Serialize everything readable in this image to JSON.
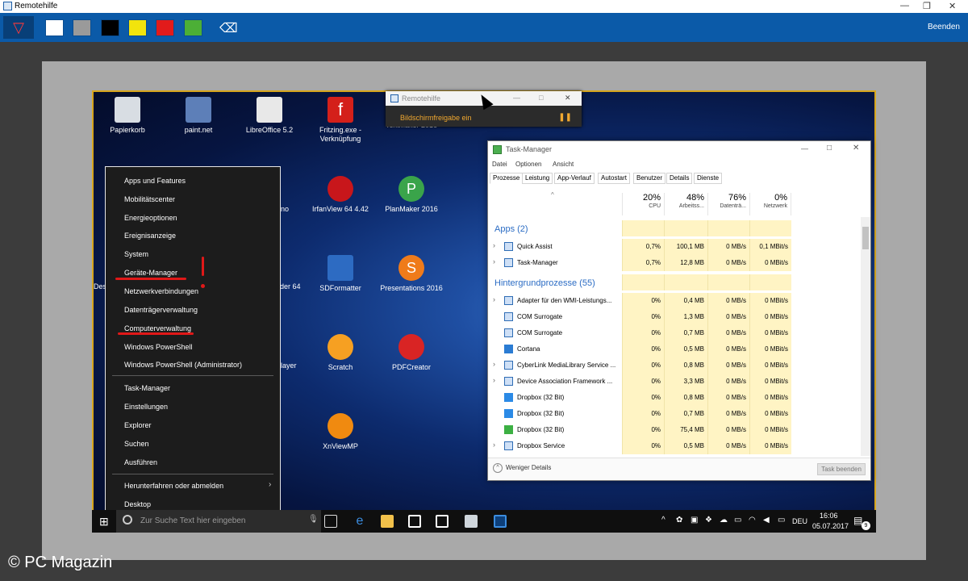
{
  "window": {
    "title": "Remotehilfe"
  },
  "toolbar": {
    "swatches": [
      "#ffffff",
      "#9a9a9a",
      "#000000",
      "#f2e40c",
      "#e21b1b",
      "#4caf36"
    ],
    "finish_label": "Beenden"
  },
  "remote_bar": {
    "title": "Remotehilfe",
    "status": "Bildschirmfreigabe ein"
  },
  "desktop_icons": [
    {
      "label": "Papierkorb"
    },
    {
      "label": "paint.net"
    },
    {
      "label": "LibreOffice 5.2"
    },
    {
      "label": "Fritzing.exe - Verknüpfung"
    },
    {
      "label": "TextMaker 2016"
    },
    {
      "label": "IrfanView 64 4.42"
    },
    {
      "label": "PlanMaker 2016"
    },
    {
      "label": "SDFormatter"
    },
    {
      "label": "Presentations 2016"
    },
    {
      "label": "Scratch"
    },
    {
      "label": "PDFCreator"
    },
    {
      "label": "XnViewMP"
    },
    {
      "label": "Desi"
    },
    {
      "label": "ino"
    },
    {
      "label": "ader 64"
    },
    {
      "label": "layer"
    }
  ],
  "context_menu": {
    "items": [
      "Apps und Features",
      "Mobilitätscenter",
      "Energieoptionen",
      "Ereignisanzeige",
      "System",
      "Geräte-Manager",
      "Netzwerkverbindungen",
      "Datenträgerverwaltung",
      "Computerverwaltung",
      "Windows PowerShell",
      "Windows PowerShell (Administrator)",
      "Task-Manager",
      "Einstellungen",
      "Explorer",
      "Suchen",
      "Ausführen",
      "Herunterfahren oder abmelden",
      "Desktop"
    ]
  },
  "taskbar": {
    "search_placeholder": "Zur Suche Text hier eingeben",
    "language": "DEU",
    "time": "16:06",
    "date": "05.07.2017",
    "notification_count": "9"
  },
  "task_manager": {
    "title": "Task-Manager",
    "menu": [
      "Datei",
      "Optionen",
      "Ansicht"
    ],
    "tabs": [
      "Prozesse",
      "Leistung",
      "App-Verlauf",
      "Autostart",
      "Benutzer",
      "Details",
      "Dienste"
    ],
    "columns": [
      {
        "pct": "20%",
        "label": "CPU"
      },
      {
        "pct": "48%",
        "label": "Arbeitss..."
      },
      {
        "pct": "76%",
        "label": "Datenträ..."
      },
      {
        "pct": "0%",
        "label": "Netzwerk"
      }
    ],
    "group_apps": "Apps (2)",
    "apps": [
      {
        "name": "Quick Assist",
        "cpu": "0,7%",
        "mem": "100,1 MB",
        "disk": "0 MB/s",
        "net": "0,1 MBit/s"
      },
      {
        "name": "Task-Manager",
        "cpu": "0,7%",
        "mem": "12,8 MB",
        "disk": "0 MB/s",
        "net": "0 MBit/s"
      }
    ],
    "group_background": "Hintergrundprozesse (55)",
    "background": [
      {
        "name": "Adapter für den WMI-Leistungs...",
        "cpu": "0%",
        "mem": "0,4 MB",
        "disk": "0 MB/s",
        "net": "0 MBit/s"
      },
      {
        "name": "COM Surrogate",
        "cpu": "0%",
        "mem": "1,3 MB",
        "disk": "0 MB/s",
        "net": "0 MBit/s"
      },
      {
        "name": "COM Surrogate",
        "cpu": "0%",
        "mem": "0,7 MB",
        "disk": "0 MB/s",
        "net": "0 MBit/s"
      },
      {
        "name": "Cortana",
        "cpu": "0%",
        "mem": "0,5 MB",
        "disk": "0 MB/s",
        "net": "0 MBit/s"
      },
      {
        "name": "CyberLink MediaLibrary Service ...",
        "cpu": "0%",
        "mem": "0,8 MB",
        "disk": "0 MB/s",
        "net": "0 MBit/s"
      },
      {
        "name": "Device Association Framework ...",
        "cpu": "0%",
        "mem": "3,3 MB",
        "disk": "0 MB/s",
        "net": "0 MBit/s"
      },
      {
        "name": "Dropbox (32 Bit)",
        "cpu": "0%",
        "mem": "0,8 MB",
        "disk": "0 MB/s",
        "net": "0 MBit/s"
      },
      {
        "name": "Dropbox (32 Bit)",
        "cpu": "0%",
        "mem": "0,7 MB",
        "disk": "0 MB/s",
        "net": "0 MBit/s"
      },
      {
        "name": "Dropbox (32 Bit)",
        "cpu": "0%",
        "mem": "75,4 MB",
        "disk": "0 MB/s",
        "net": "0 MBit/s"
      },
      {
        "name": "Dropbox Service",
        "cpu": "0%",
        "mem": "0,5 MB",
        "disk": "0 MB/s",
        "net": "0 MBit/s"
      }
    ],
    "fewer_details": "Weniger Details",
    "end_task": "Task beenden"
  },
  "watermark": "© PC Magazin"
}
